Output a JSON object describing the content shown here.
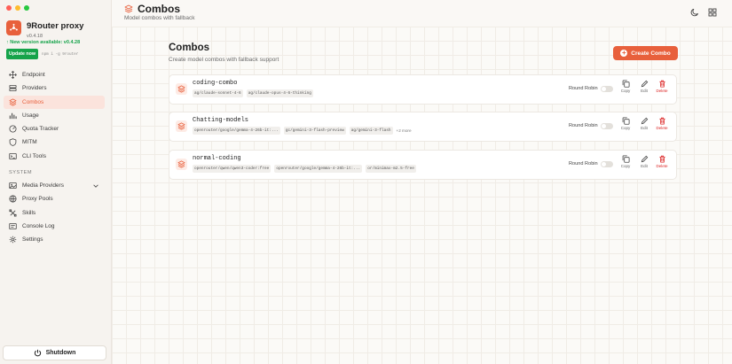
{
  "app": {
    "name": "9Router proxy",
    "version": "v0.4.18",
    "new_version": "New version available: v0.4.28",
    "update_label": "Update now",
    "npm_command": "npm i -g 9router"
  },
  "sidebar": {
    "items": [
      {
        "label": "Endpoint",
        "icon": "endpoint-icon",
        "active": false
      },
      {
        "label": "Providers",
        "icon": "providers-icon",
        "active": false
      },
      {
        "label": "Combos",
        "icon": "combos-icon",
        "active": true
      },
      {
        "label": "Usage",
        "icon": "usage-icon",
        "active": false
      },
      {
        "label": "Quota Tracker",
        "icon": "quota-icon",
        "active": false
      },
      {
        "label": "MITM",
        "icon": "shield-icon",
        "active": false
      },
      {
        "label": "CLI Tools",
        "icon": "terminal-icon",
        "active": false
      }
    ],
    "system_label": "SYSTEM",
    "system_items": [
      {
        "label": "Media Providers",
        "icon": "media-icon"
      },
      {
        "label": "Proxy Pools",
        "icon": "pools-icon"
      },
      {
        "label": "Skills",
        "icon": "skills-icon"
      },
      {
        "label": "Console Log",
        "icon": "console-icon"
      },
      {
        "label": "Settings",
        "icon": "gear-icon"
      }
    ],
    "shutdown_label": "Shutdown"
  },
  "header": {
    "title": "Combos",
    "subtitle": "Model combos with fallback"
  },
  "main": {
    "title": "Combos",
    "subtitle": "Create model combos with fallback support",
    "create_label": "Create Combo",
    "round_robin_label": "Round Robin",
    "copy_label": "Copy",
    "edit_label": "Edit",
    "delete_label": "Delete",
    "combos": [
      {
        "name": "coding-combo",
        "models": [
          "ag/claude-sonnet-4-6",
          "ag/claude-opus-4-6-thinking"
        ],
        "more": ""
      },
      {
        "name": "Chatting-models",
        "models": [
          "openrouter/google/gemma-4-26b-it:...",
          "gc/gemini-3-flash-preview",
          "ag/gemini-3-flash"
        ],
        "more": "+2 more"
      },
      {
        "name": "normal-coding",
        "models": [
          "openrouter/qwen/qwen3-coder:free",
          "openrouter/google/gemma-4-26b-it:...",
          "or/minimax-m2.5-free"
        ],
        "more": ""
      }
    ]
  },
  "colors": {
    "accent": "#e8603c",
    "success": "#16a34a",
    "danger": "#dc2626"
  }
}
